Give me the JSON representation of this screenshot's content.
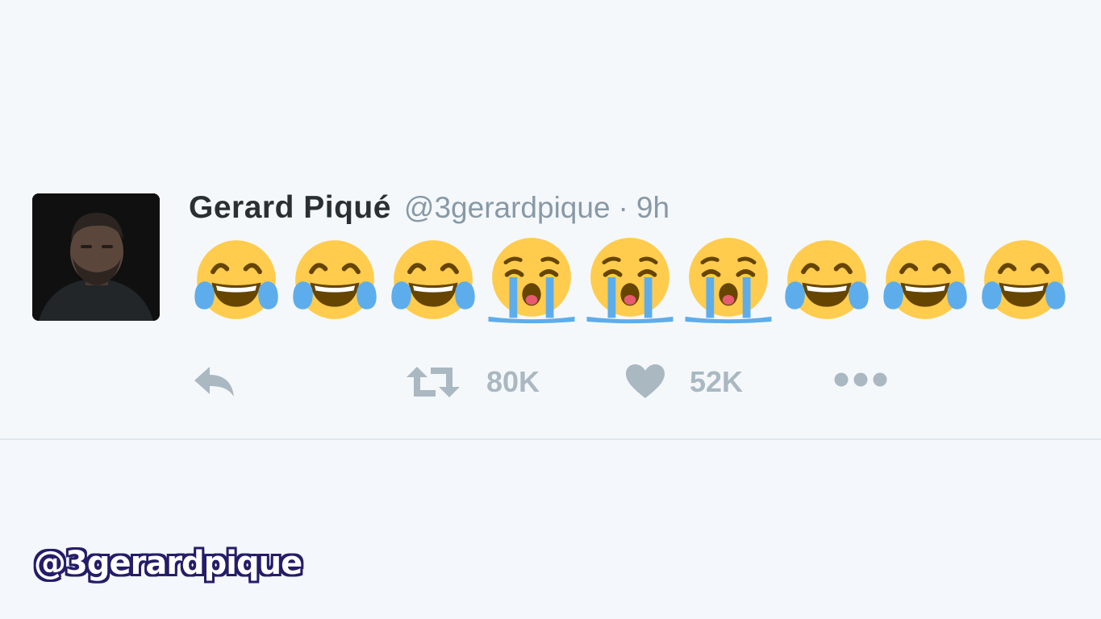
{
  "tweet": {
    "author_name": "Gerard Piqué",
    "author_handle": "@3gerardpique",
    "separator": "·",
    "time": "9h",
    "emojis": [
      "face-with-tears-of-joy",
      "face-with-tears-of-joy",
      "face-with-tears-of-joy",
      "loudly-crying-face",
      "loudly-crying-face",
      "loudly-crying-face",
      "face-with-tears-of-joy",
      "face-with-tears-of-joy",
      "face-with-tears-of-joy"
    ],
    "retweet_count": "80K",
    "like_count": "52K"
  },
  "icons": {
    "reply": "reply-icon",
    "retweet": "retweet-icon",
    "like": "heart-icon",
    "more": "more-icon"
  },
  "colors": {
    "background": "#f5f8fb",
    "name": "#292f33",
    "handle": "#8899a6",
    "action_gray": "#aab8c2",
    "emoji_yellow": "#ffcc4d",
    "tear_blue": "#5dadec",
    "watermark_outline": "#241d68"
  },
  "watermark": {
    "text": "@3gerardpique"
  }
}
